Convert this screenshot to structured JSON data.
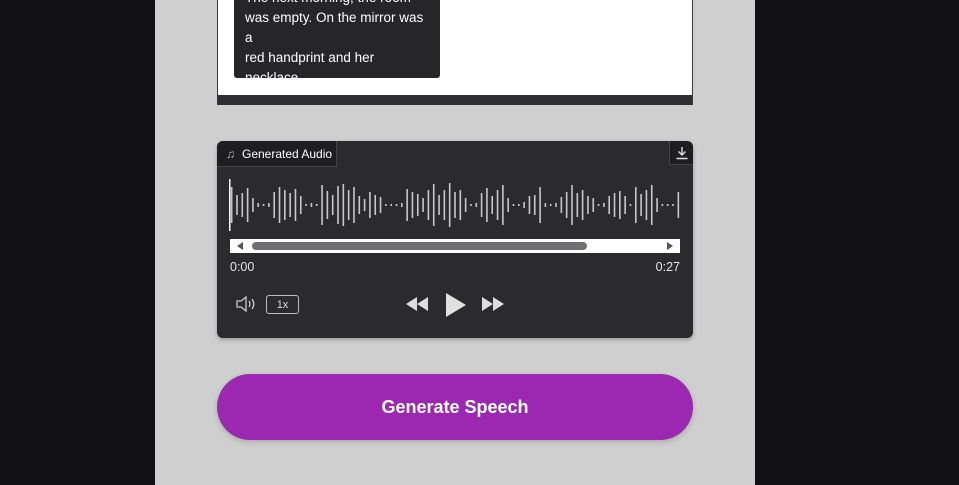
{
  "story": {
    "tooltip_lines": [
      "The next morning, the room",
      "was empty. On the mirror was a",
      "red handprint and her",
      "necklace."
    ]
  },
  "player": {
    "tab_icon": "music-note-icon",
    "tab_label": "Generated Audio",
    "download_icon": "download-icon",
    "time_current": "0:00",
    "time_total": "0:27",
    "speed_label": "1x",
    "progress": 0.0
  },
  "actions": {
    "generate_label": "Generate Speech"
  },
  "colors": {
    "accent": "#9c27b0",
    "player_bg": "#2b2b2d",
    "panel_bg": "#cfcfcf",
    "page_bg": "#111113"
  }
}
